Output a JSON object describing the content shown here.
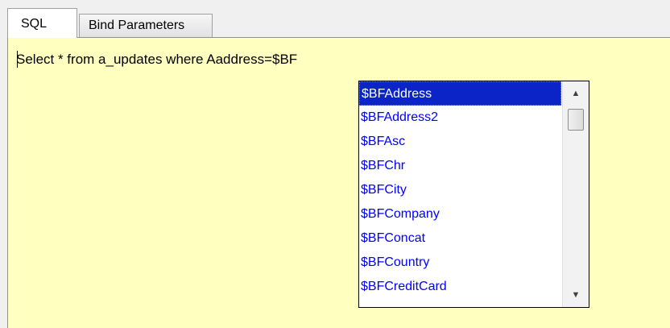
{
  "tabs": [
    {
      "label": "SQL",
      "active": true
    },
    {
      "label": "Bind Parameters",
      "active": false
    }
  ],
  "editor": {
    "sql_text": "Select * from a_updates where Aaddress=$BF",
    "background": "#ffffc0"
  },
  "autocomplete": {
    "selected_index": 0,
    "items": [
      "$BFAddress",
      "$BFAddress2",
      "$BFAsc",
      "$BFChr",
      "$BFCity",
      "$BFCompany",
      "$BFConcat",
      "$BFCountry",
      "$BFCreditCard"
    ],
    "selected_color": "#0a24c8",
    "item_color": "#0000ff"
  },
  "scrollbar": {
    "up_icon": "scroll-up-arrow-icon",
    "down_icon": "scroll-down-arrow-icon"
  }
}
